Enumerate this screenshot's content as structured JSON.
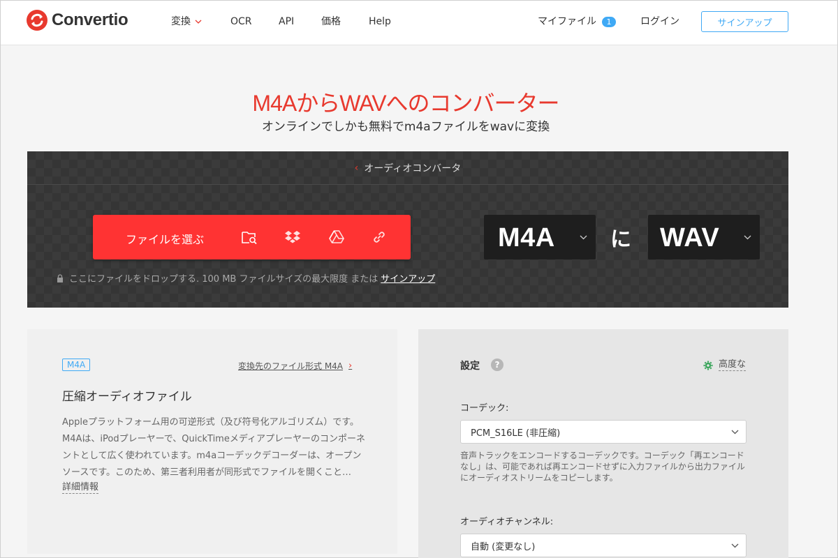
{
  "header": {
    "brand": "Convertio",
    "nav": [
      {
        "label": "変換"
      },
      {
        "label": "OCR"
      },
      {
        "label": "API"
      },
      {
        "label": "価格"
      },
      {
        "label": "Help"
      }
    ],
    "my_files": "マイファイル",
    "my_files_count": "1",
    "login": "ログイン",
    "signup": "サインアップ"
  },
  "hero": {
    "title": "M4AからWAVへのコンバーター",
    "subtitle": "オンラインでしかも無料でm4aファイルをwavに変換"
  },
  "converter": {
    "breadcrumb": "オーディオコンバータ",
    "choose_label": "ファイルを選ぶ",
    "sources": [
      "folder-search-icon",
      "dropbox-icon",
      "google-drive-icon",
      "url-link-icon"
    ],
    "drop_note": "ここにファイルをドロップする. 100 MB ファイルサイズの最大限度 または",
    "drop_note_link": "サインアップ",
    "from_format": "M4A",
    "connector": "に",
    "to_format": "WAV",
    "accent_color": "#ff3333"
  },
  "info": {
    "tag": "M4A",
    "target_link": "変換先のファイル形式 M4A",
    "title": "圧縮オーディオファイル",
    "description": "Appleプラットフォーム用の可逆形式（及び符号化アルゴリズム）です。M4Aは、iPodプレーヤーで、QuickTimeメディアプレーヤーのコンポーネントとして広く使われています。m4aコーデックデコーダーは、オープンソースです。このため、第三者利用者が同形式でファイルを開くこと…",
    "more_link": "詳細情報"
  },
  "settings": {
    "title": "設定",
    "help": "?",
    "advanced": "高度な",
    "codec_label": "コーデック:",
    "codec_value": "PCM_S16LE (非圧縮)",
    "codec_help": "音声トラックをエンコードするコーデックです。コーデック「再エンコードなし」は、可能であれば再エンコードせずに入力ファイルから出力ファイルにオーディオストリームをコピーします。",
    "channel_label": "オーディオチャンネル:",
    "channel_value": "自動 (変更なし)"
  }
}
